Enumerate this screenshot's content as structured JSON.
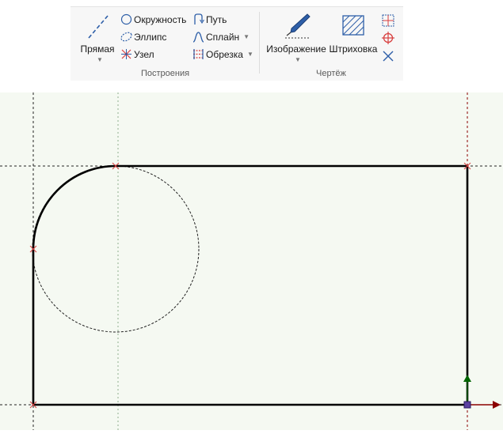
{
  "ribbon": {
    "group_construct": {
      "title": "Построения",
      "line_label": "Прямая",
      "circle_label": "Окружность",
      "ellipse_label": "Эллипс",
      "node_label": "Узел",
      "path_label": "Путь",
      "spline_label": "Сплайн",
      "trim_label": "Обрезка"
    },
    "group_drawing": {
      "title": "Чертёж",
      "image_label": "Изображение",
      "hatch_label": "Штриховка"
    }
  },
  "icons": {
    "line": "line-icon",
    "circle": "circle-icon",
    "ellipse": "ellipse-icon",
    "node": "node-icon",
    "path": "path-icon",
    "spline": "spline-icon",
    "trim": "trim-icon",
    "image": "pen-icon",
    "hatch": "hatch-icon",
    "small": [
      "snap-grid-icon",
      "target-icon",
      "cross-icon"
    ]
  },
  "colors": {
    "canvas_bg": "#f5f9f2",
    "ribbon_bg": "#f7f7f7",
    "contour": "#000000",
    "node_marker": "#d84040",
    "axis_x": "#8b0000",
    "axis_y": "#006400",
    "icon_blue": "#2e5fa8"
  }
}
